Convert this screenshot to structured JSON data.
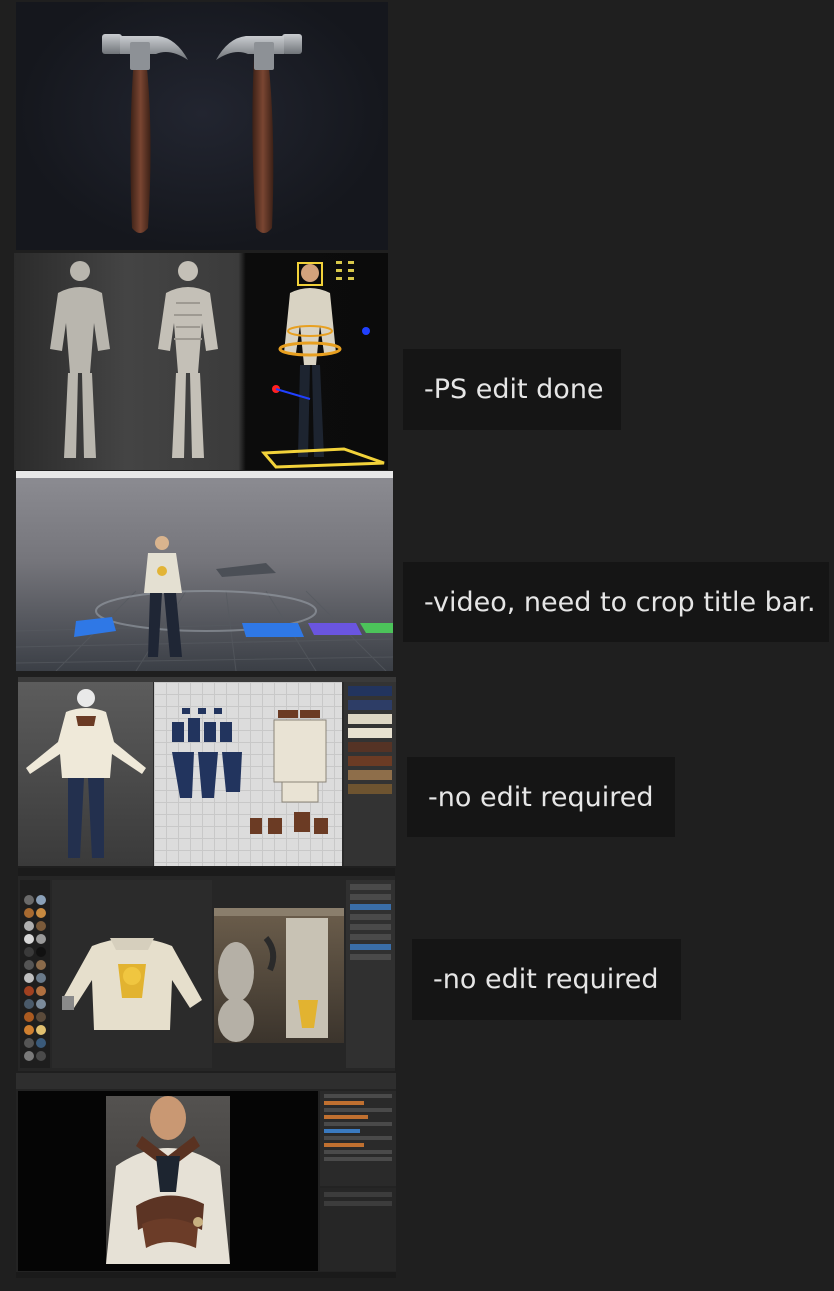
{
  "notes": [
    {
      "text": "-PS edit done"
    },
    {
      "text": "-video, need to crop title bar."
    },
    {
      "text": "-no edit required"
    },
    {
      "text": "-no edit required"
    }
  ],
  "images": [
    {
      "id": "hammers",
      "name": "hammer render"
    },
    {
      "id": "characters",
      "name": "character sculpt and rig"
    },
    {
      "id": "video",
      "name": "animation sample video"
    },
    {
      "id": "pattern",
      "name": "garment pattern editor"
    },
    {
      "id": "painter",
      "name": "texture painting app"
    },
    {
      "id": "compositor",
      "name": "portrait render editor"
    }
  ],
  "colors": {
    "page_bg": "#1f1f1f",
    "note_bg": "#151515",
    "note_text": "#e6e6e6"
  }
}
